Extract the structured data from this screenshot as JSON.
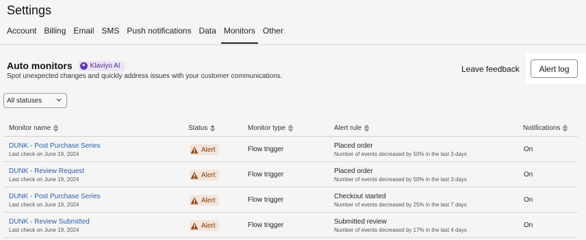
{
  "header": {
    "title": "Settings",
    "tabs": [
      {
        "label": "Account",
        "active": false
      },
      {
        "label": "Billing",
        "active": false
      },
      {
        "label": "Email",
        "active": false
      },
      {
        "label": "SMS",
        "active": false
      },
      {
        "label": "Push notifications",
        "active": false
      },
      {
        "label": "Data",
        "active": false
      },
      {
        "label": "Monitors",
        "active": true
      },
      {
        "label": "Other",
        "active": false
      }
    ]
  },
  "section": {
    "title": "Auto monitors",
    "ai_badge": "Klaviyo AI",
    "description": "Spot unexpected changes and quickly address issues with your customer communications.",
    "leave_feedback": "Leave feedback",
    "alert_log": "Alert log"
  },
  "filter": {
    "selected": "All statuses"
  },
  "table": {
    "columns": [
      "Monitor name",
      "Status",
      "Monitor type",
      "Alert rule",
      "Notifications"
    ],
    "rows": [
      {
        "name": "DUNK - Post Purchase Series",
        "last_check": "Last check on June 19, 2024",
        "status": "Alert",
        "type": "Flow trigger",
        "rule": "Placed order",
        "rule_detail": "Number of events decreased by 50% in the last 3 days",
        "notifications": "On"
      },
      {
        "name": "DUNK - Review Request",
        "last_check": "Last check on June 19, 2024",
        "status": "Alert",
        "type": "Flow trigger",
        "rule": "Placed order",
        "rule_detail": "Number of events decreased by 50% in the last 3 days",
        "notifications": "On"
      },
      {
        "name": "DUNK - Post Purchase Series",
        "last_check": "Last check on June 19, 2024",
        "status": "Alert",
        "type": "Flow trigger",
        "rule": "Checkout started",
        "rule_detail": "Number of events decreased by 25% in the last 7 days",
        "notifications": "On"
      },
      {
        "name": "DUNK - Review Submitted",
        "last_check": "Last check on June 19, 2024",
        "status": "Alert",
        "type": "Flow trigger",
        "rule": "Submitted review",
        "rule_detail": "Number of events decreased by 17% in the last 4 days",
        "notifications": "On"
      }
    ]
  },
  "colors": {
    "link": "#2b5ea7",
    "alert_badge_bg": "#f4e4d9",
    "alert_icon": "#8a4a1c",
    "ai_badge_bg": "#ece3f7"
  }
}
